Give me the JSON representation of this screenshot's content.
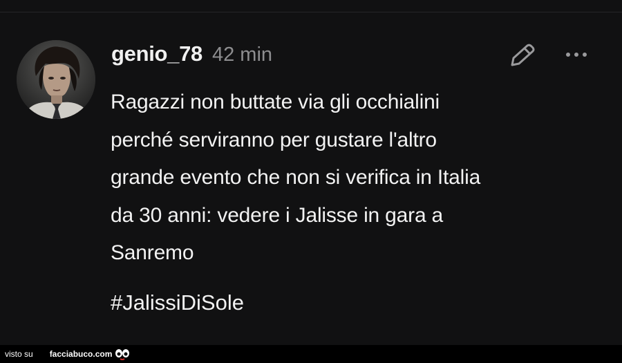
{
  "post": {
    "username": "genio_78",
    "timestamp": "42 min",
    "text": "Ragazzi non buttate via gli occhialini\nperché serviranno per gustare l'altro\ngrande evento che non si verifica in Italia\nda 30 anni: vedere i Jalisse in gara a\nSanremo",
    "hashtag": "#JalissiDiSole"
  },
  "icons": {
    "edit": "pencil-icon",
    "more": "more-dots-icon"
  },
  "watermark": {
    "prefix": "visto su",
    "site": "facciabuco.com",
    "logo_text": "facciabuco.com"
  },
  "colors": {
    "background": "#111112",
    "text": "#f2f2f2",
    "muted": "#8d8d8f"
  }
}
